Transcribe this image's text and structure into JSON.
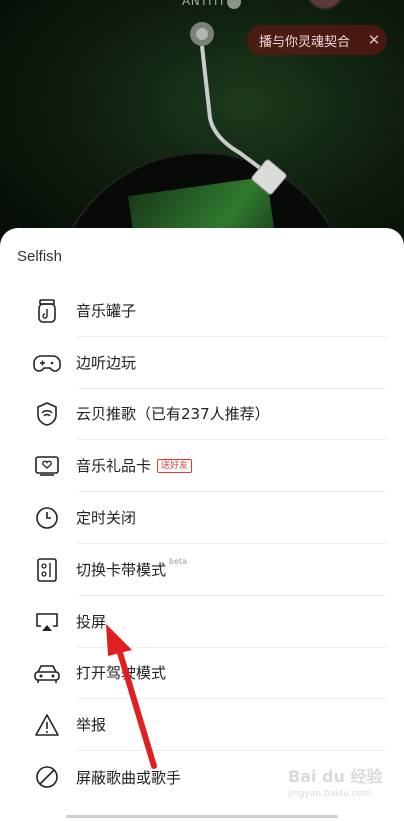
{
  "player": {
    "artist": "ANTITI",
    "share_text": "播与你灵魂契合"
  },
  "sheet": {
    "title": "Selfish",
    "items": [
      {
        "label": "音乐罐子",
        "icon": "jar-icon"
      },
      {
        "label": "边听边玩",
        "icon": "gamepad-icon"
      },
      {
        "label": "云贝推歌（已有237人推荐）",
        "icon": "cloud-coin-icon"
      },
      {
        "label": "音乐礼品卡",
        "icon": "gift-card-icon",
        "tag": "送好友"
      },
      {
        "label": "定时关闭",
        "icon": "clock-icon"
      },
      {
        "label": "切换卡带模式",
        "icon": "cassette-icon",
        "sup": "beta"
      },
      {
        "label": "投屏",
        "icon": "cast-screen-icon"
      },
      {
        "label": "打开驾驶模式",
        "icon": "car-icon"
      },
      {
        "label": "举报",
        "icon": "warning-icon"
      },
      {
        "label": "屏蔽歌曲或歌手",
        "icon": "block-icon"
      }
    ]
  },
  "watermark": {
    "brand": "Bai du 经验",
    "sub": "jingyan.baidu.com"
  },
  "colors": {
    "accent": "#e03a3a",
    "text": "#222222",
    "background_dark": "#0b120b"
  }
}
